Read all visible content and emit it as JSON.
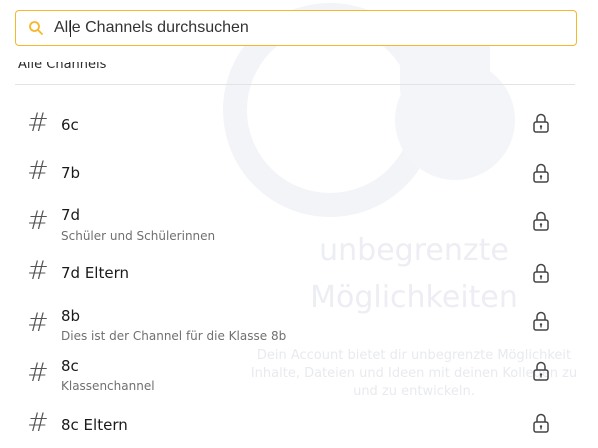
{
  "search": {
    "placeholder": "Alle Channels durchsuchen",
    "value": ""
  },
  "section_title": "Alle Channels",
  "background": {
    "headline_1": "unbegrenzte",
    "headline_2": "Möglichkeiten",
    "text_lines": [
      "Dein Account bietet dir unbegrenzte Möglichkeit",
      "Inhalte, Dateien und Ideen mit deinen Kollegen zu",
      "und zu entwickeln."
    ]
  },
  "channels": [
    {
      "symbol": "#",
      "name": "6c",
      "description": ""
    },
    {
      "symbol": "#",
      "name": "7b",
      "description": ""
    },
    {
      "symbol": "#",
      "name": "7d",
      "description": "Schüler und Schülerinnen"
    },
    {
      "symbol": "#",
      "name": "7d Eltern",
      "description": ""
    },
    {
      "symbol": "#",
      "name": "8b",
      "description": "Dies ist der Channel für die Klasse 8b"
    },
    {
      "symbol": "#",
      "name": "8c",
      "description": "Klassenchannel"
    },
    {
      "symbol": "#",
      "name": "8c Eltern",
      "description": ""
    }
  ],
  "icons": {
    "search": "search-icon",
    "lock": "lock-icon"
  },
  "colors": {
    "accent": "#f5b82a",
    "text": "#1a1a1a",
    "muted": "#707070",
    "divider": "#e3e3e3"
  }
}
